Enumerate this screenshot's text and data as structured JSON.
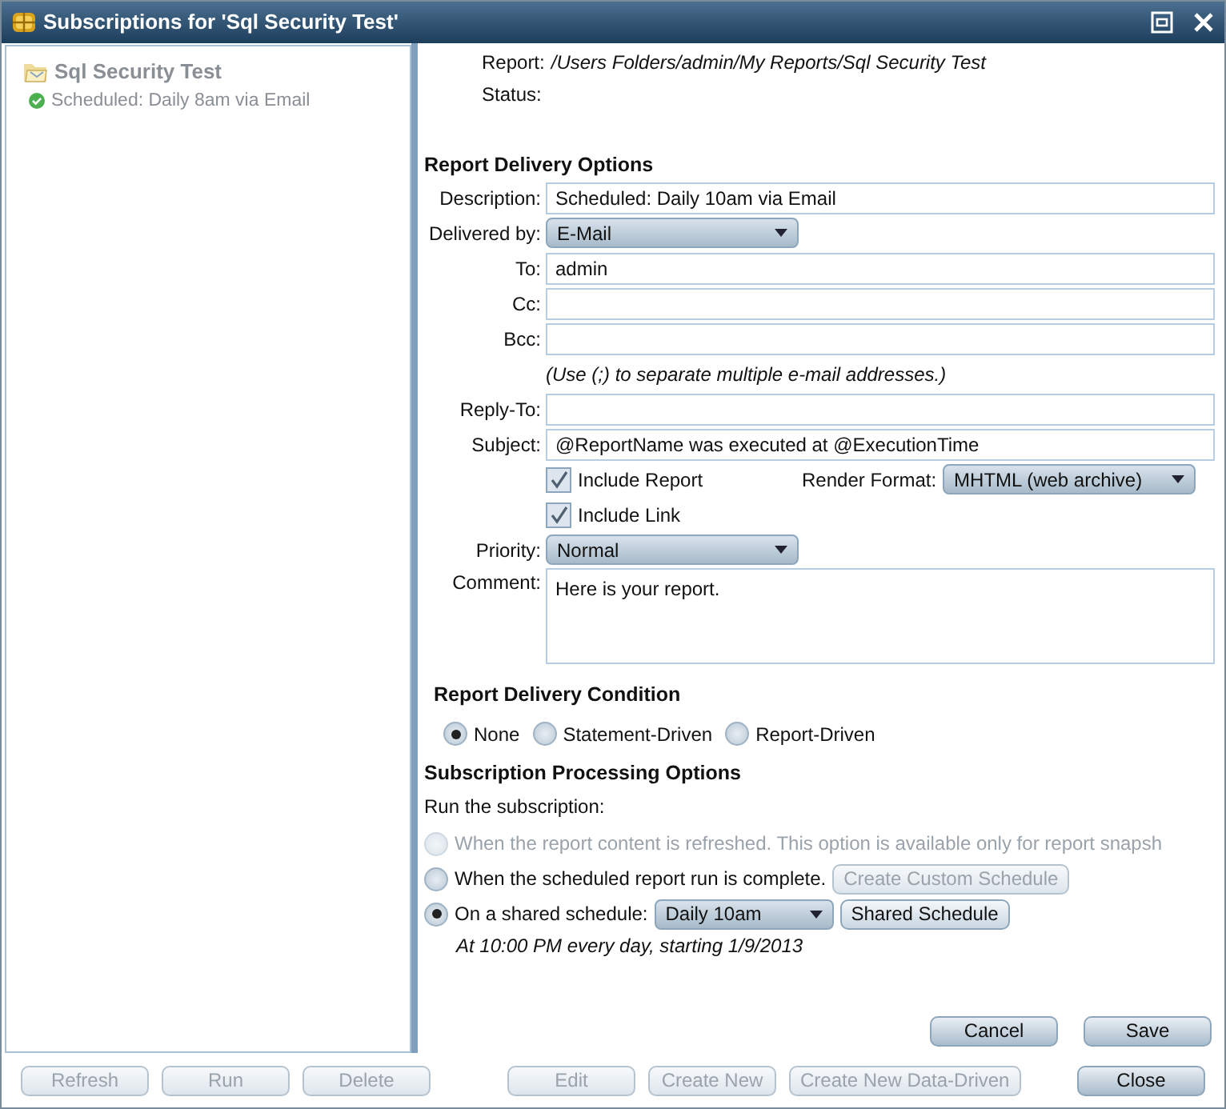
{
  "window": {
    "title": "Subscriptions for 'Sql Security Test'"
  },
  "tree": {
    "title": "Sql Security Test",
    "children": [
      {
        "label": "Scheduled: Daily 8am via Email",
        "ok": true
      }
    ]
  },
  "header": [
    {
      "label": "Report:",
      "value": "/Users Folders/admin/My Reports/Sql Security Test"
    },
    {
      "label": "Status:"
    }
  ],
  "delivery_options": {
    "heading": "Report Delivery Options",
    "fields": [
      {
        "kind": "text",
        "label": "Description:",
        "value": "Scheduled: Daily 10am via Email"
      },
      {
        "kind": "dropdown",
        "label": "Delivered by:",
        "value": "E-Mail"
      },
      {
        "kind": "text",
        "label": "To:",
        "value": "admin"
      },
      {
        "kind": "text",
        "label": "Cc:"
      },
      {
        "kind": "text",
        "label": "Bcc:"
      },
      {
        "kind": "note",
        "text": "(Use (;) to separate multiple e-mail addresses.)"
      },
      {
        "kind": "text",
        "label": "Reply-To:"
      },
      {
        "kind": "text",
        "label": "Subject:",
        "value": "@ReportName was executed at @ExecutionTime"
      },
      {
        "kind": "checkbox",
        "label": "Include Report",
        "checked": true,
        "side": {
          "label": "Render Format:",
          "value": "MHTML (web archive)"
        }
      },
      {
        "kind": "checkbox",
        "label": "Include Link",
        "checked": true
      },
      {
        "kind": "dropdown",
        "label": "Priority:",
        "value": "Normal"
      },
      {
        "kind": "textarea",
        "label": "Comment:",
        "value": "Here is your report."
      }
    ]
  },
  "delivery_condition": {
    "heading": "Report Delivery Condition",
    "options": [
      {
        "label": "None",
        "selected": true
      },
      {
        "label": "Statement-Driven",
        "selected": false
      },
      {
        "label": "Report-Driven",
        "selected": false
      }
    ]
  },
  "processing": {
    "heading": "Subscription Processing Options",
    "intro": "Run the subscription:",
    "options": [
      {
        "label": "When the report content is refreshed. This option is available only for report snapsh",
        "selected": false,
        "disabled": true
      },
      {
        "label": "When the scheduled report run is complete.",
        "selected": false,
        "disabled": false,
        "button": {
          "label": "Create Custom Schedule",
          "disabled": true
        }
      },
      {
        "label": "On a shared schedule:",
        "selected": true,
        "disabled": false,
        "dropdown": "Daily 10am",
        "button": {
          "label": "Shared Schedule",
          "disabled": false
        }
      }
    ],
    "schedule_note": "At 10:00 PM every day, starting 1/9/2013"
  },
  "form_buttons": [
    {
      "label": "Cancel",
      "disabled": false
    },
    {
      "label": "Save",
      "disabled": false
    }
  ],
  "footer_left": [
    {
      "label": "Refresh",
      "disabled": true
    },
    {
      "label": "Run",
      "disabled": true
    },
    {
      "label": "Delete",
      "disabled": true
    }
  ],
  "footer_right": [
    {
      "label": "Edit",
      "disabled": true
    },
    {
      "label": "Create New",
      "disabled": true
    },
    {
      "label": "Create New Data-Driven",
      "disabled": true
    },
    {
      "label": "Close",
      "disabled": false
    }
  ]
}
